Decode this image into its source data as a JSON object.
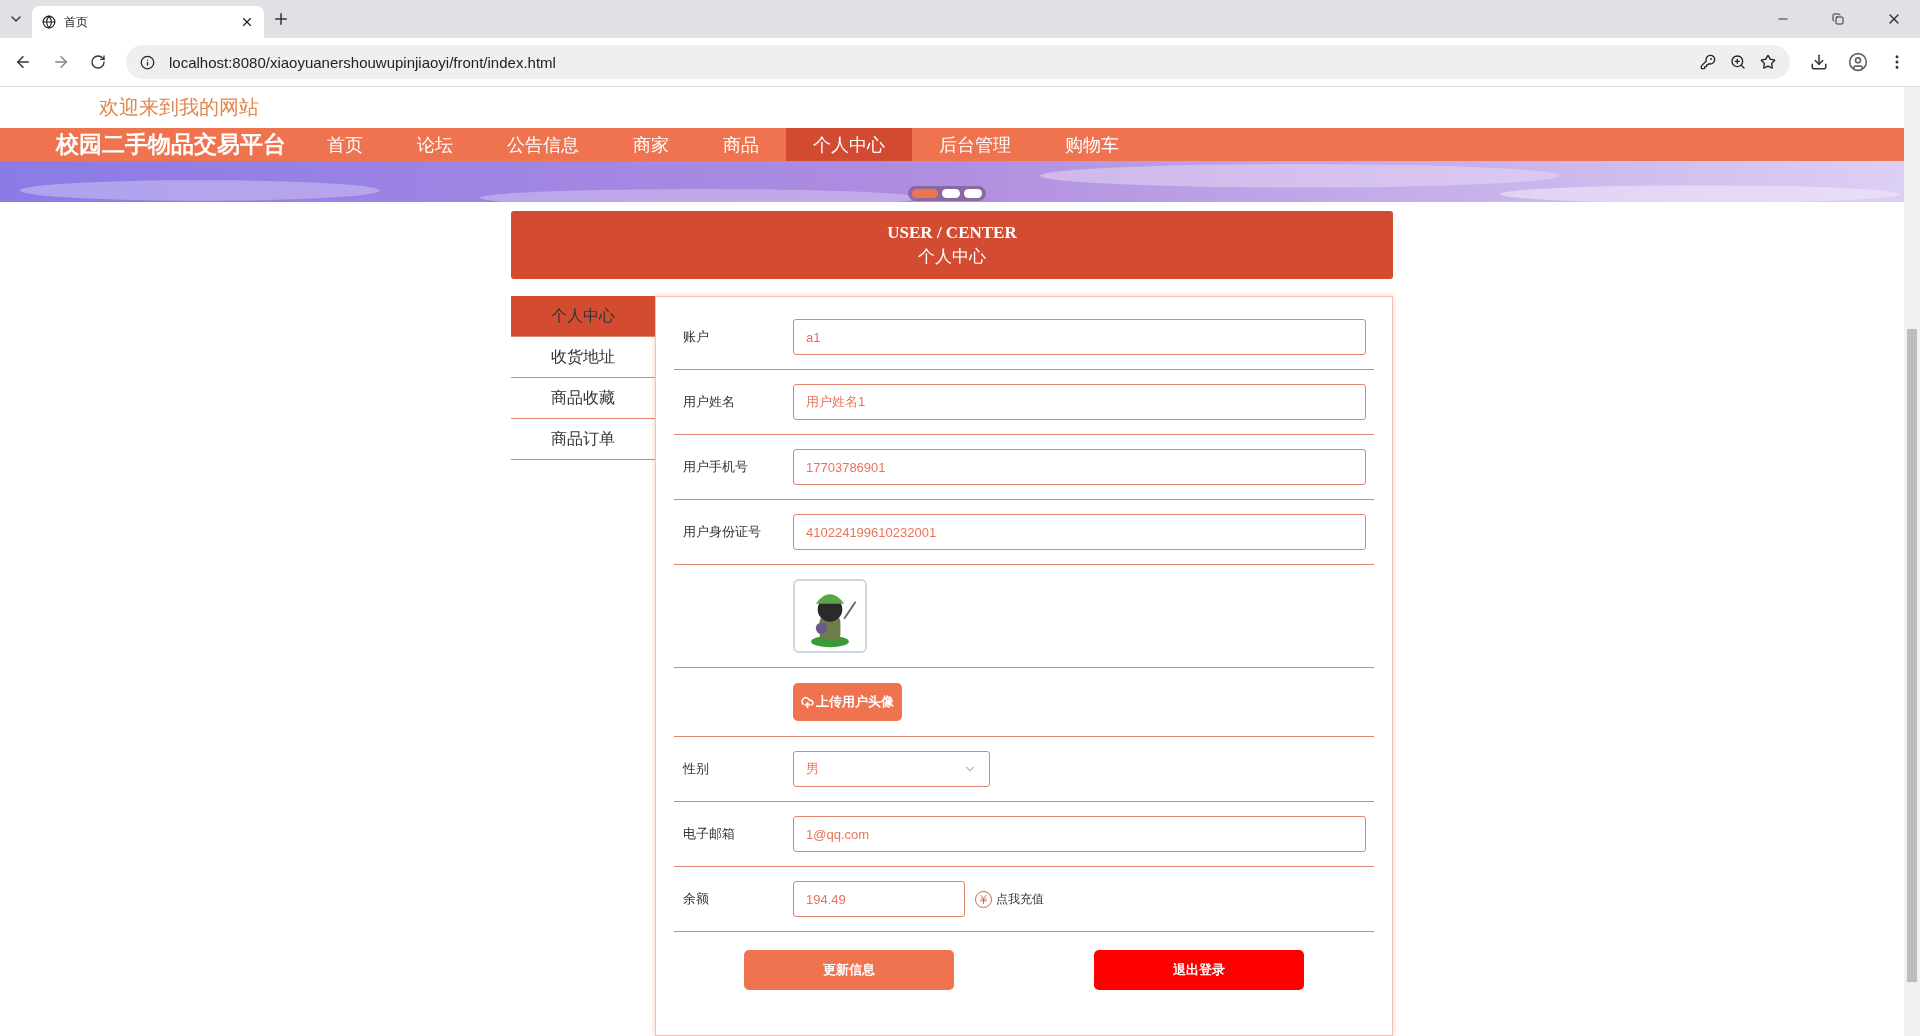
{
  "browser": {
    "tab_title": "首页",
    "url": "localhost:8080/xiaoyuanershouwupinjiaoyi/front/index.html"
  },
  "site": {
    "welcome": "欢迎来到我的网站",
    "logo": "校园二手物品交易平台",
    "nav": [
      {
        "label": "首页",
        "selected": false
      },
      {
        "label": "论坛",
        "selected": false
      },
      {
        "label": "公告信息",
        "selected": false
      },
      {
        "label": "商家",
        "selected": false
      },
      {
        "label": "商品",
        "selected": false
      },
      {
        "label": "个人中心",
        "selected": true
      },
      {
        "label": "后台管理",
        "selected": false
      },
      {
        "label": "购物车",
        "selected": false
      }
    ],
    "carousel_dots": [
      {
        "selected": true
      },
      {
        "selected": false
      },
      {
        "selected": false
      }
    ]
  },
  "header": {
    "title_en": "USER / CENTER",
    "title_zh": "个人中心"
  },
  "sidebar": {
    "items": [
      {
        "label": "个人中心",
        "selected": true
      },
      {
        "label": "收货地址",
        "selected": false
      },
      {
        "label": "商品收藏",
        "selected": false
      },
      {
        "label": "商品订单",
        "selected": false
      }
    ]
  },
  "form": {
    "rows": [
      {
        "kind": "text",
        "label": "账户",
        "value": "a1"
      },
      {
        "kind": "text",
        "label": "用户姓名",
        "value": "用户姓名1"
      },
      {
        "kind": "text",
        "label": "用户手机号",
        "value": "17703786901"
      },
      {
        "kind": "text",
        "label": "用户身份证号",
        "value": "410224199610232001"
      },
      {
        "kind": "avatar"
      },
      {
        "kind": "upload",
        "button": "上传用户头像"
      },
      {
        "kind": "select",
        "label": "性别",
        "value": "男"
      },
      {
        "kind": "text",
        "label": "电子邮箱",
        "value": "1@qq.com"
      },
      {
        "kind": "balance",
        "label": "余额",
        "value": "194.49",
        "link": "点我充值"
      }
    ],
    "buttons": [
      {
        "kind": "primary",
        "label": "更新信息"
      },
      {
        "kind": "danger",
        "label": "退出登录"
      }
    ]
  }
}
